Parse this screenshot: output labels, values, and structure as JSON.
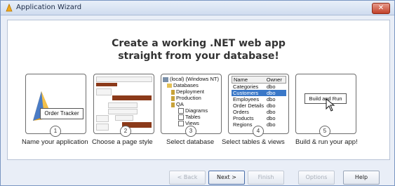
{
  "window": {
    "title": "Application Wizard",
    "close_label": "✕"
  },
  "headline": {
    "line1": "Create a working .NET web app",
    "line2": "straight from your database!"
  },
  "steps": [
    {
      "number": "1",
      "label": "Name your application",
      "preview_text": "Order Tracker"
    },
    {
      "number": "2",
      "label": "Choose a page style"
    },
    {
      "number": "3",
      "label": "Select database",
      "tree": [
        "(local) (Windows NT)",
        "Databases",
        "Deployment",
        "Production",
        "QA",
        "Diagrams",
        "Tables",
        "Views"
      ]
    },
    {
      "number": "4",
      "label": "Select tables & views",
      "grid_headers": [
        "Name",
        "Owner"
      ],
      "grid_rows": [
        [
          "Categories",
          "dbo"
        ],
        [
          "Customers",
          "dbo"
        ],
        [
          "Employees",
          "dbo"
        ],
        [
          "Order Details",
          "dbo"
        ],
        [
          "Orders",
          "dbo"
        ],
        [
          "Products",
          "dbo"
        ],
        [
          "Regions",
          "dbo"
        ]
      ]
    },
    {
      "number": "5",
      "label": "Build & run your app!",
      "preview_button": "Build and Run"
    }
  ],
  "buttons": {
    "back": "< Back",
    "next": "Next >",
    "finish": "Finish",
    "options": "Options",
    "help": "Help"
  }
}
